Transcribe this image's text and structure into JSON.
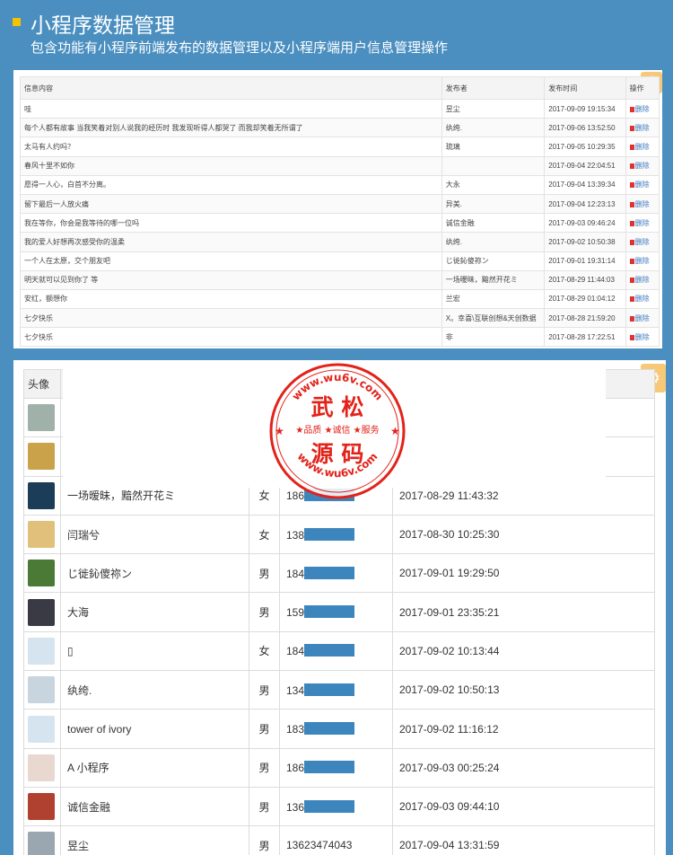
{
  "header": {
    "title": "小程序数据管理",
    "subtitle": "包含功能有小程序前端发布的数据管理以及小程序端用户信息管理操作"
  },
  "messages": {
    "columns": [
      "信息内容",
      "发布者",
      "发布时间",
      "操作"
    ],
    "delete_label": "删除",
    "rows": [
      {
        "content": "哇",
        "author": "昱尘",
        "time": "2017-09-09 19:15:34"
      },
      {
        "content": "每个人都有故事 当我笑着对别人说我的经历时 我发现听得人都哭了 而我却笑着无所谓了",
        "author": "纨绔.",
        "time": "2017-09-06 13:52:50"
      },
      {
        "content": "太马有人约吗？",
        "author": "琉璃",
        "time": "2017-09-05 10:29:35"
      },
      {
        "content": "春风十里不如你",
        "author": "",
        "time": "2017-09-04 22:04:51"
      },
      {
        "content": "愿得一人心，白首不分离。",
        "author": "大永",
        "time": "2017-09-04 13:39:34"
      },
      {
        "content": "留下最后一人放火痛",
        "author": "异美.",
        "time": "2017-09-04 12:23:13"
      },
      {
        "content": "我在等你，你会是我等待的哪一位吗",
        "author": "诚信金融",
        "time": "2017-09-03 09:46:24"
      },
      {
        "content": "我的爱人好想再次感受你的温柔",
        "author": "纨绔.",
        "time": "2017-09-02 10:50:38"
      },
      {
        "content": "一个人在太原，交个朋友吧",
        "author": "じ徙鈊傻祢ン",
        "time": "2017-09-01 19:31:14"
      },
      {
        "content": "明天就可以见到你了 等",
        "author": "一场暧昧，黯然开花ミ",
        "time": "2017-08-29 11:44:03"
      },
      {
        "content": "安红，额想你",
        "author": "兰宏",
        "time": "2017-08-29 01:04:12"
      },
      {
        "content": "七夕快乐",
        "author": "X。幸喜\\互联创想&天创数据",
        "time": "2017-08-28 21:59:20"
      },
      {
        "content": "七夕快乐",
        "author": "非",
        "time": "2017-08-28 17:22:51"
      }
    ]
  },
  "users": {
    "header_label": "头像",
    "rows": [
      {
        "name": "",
        "gender": "",
        "phone": "",
        "time": "",
        "avatar_color": "#9fb1a8"
      },
      {
        "name": "",
        "gender": "",
        "phone": "",
        "time": "",
        "avatar_color": "#c9a24a"
      },
      {
        "name": "一场暧昧，黯然开花ミ",
        "gender": "女",
        "phone": "186",
        "time": "2017-08-29 11:43:32",
        "avatar_color": "#1c3d58"
      },
      {
        "name": "闫瑞兮",
        "gender": "女",
        "phone": "138",
        "time": "2017-08-30 10:25:30",
        "avatar_color": "#e0c07a"
      },
      {
        "name": "じ徙鈊傻祢ン",
        "gender": "男",
        "phone": "184",
        "time": "2017-09-01 19:29:50",
        "avatar_color": "#4a7a35"
      },
      {
        "name": "大海",
        "gender": "男",
        "phone": "159",
        "time": "2017-09-01 23:35:21",
        "avatar_color": "#3a3a44"
      },
      {
        "name": "▯",
        "gender": "女",
        "phone": "184",
        "time": "2017-09-02 10:13:44",
        "avatar_color": "#d6e4ef"
      },
      {
        "name": "纨绔.",
        "gender": "男",
        "phone": "134",
        "time": "2017-09-02 10:50:13",
        "avatar_color": "#c8d4de"
      },
      {
        "name": "tower of ivory",
        "gender": "男",
        "phone": "183",
        "time": "2017-09-02 11:16:12",
        "avatar_color": "#d6e4ef"
      },
      {
        "name": "A 小程序",
        "gender": "男",
        "phone": "186",
        "time": "2017-09-03 00:25:24",
        "avatar_color": "#e8d8d0"
      },
      {
        "name": "诚信金融",
        "gender": "男",
        "phone": "136",
        "time": "2017-09-03 09:44:10",
        "avatar_color": "#b04030"
      },
      {
        "name": "昱尘",
        "gender": "男",
        "phone": "13623474043",
        "time": "2017-09-04 13:31:59",
        "avatar_color": "#9aa6b0"
      }
    ]
  },
  "watermark": {
    "top_text": "www.wu6v.com",
    "line1": "武 松",
    "middle": "★品质 ★诚信 ★服务",
    "line2": "源 码",
    "bottom_text": "www.wu6v.com",
    "color": "#e2231a"
  },
  "icons": {
    "gear": "gear-icon",
    "delete": "trash-icon"
  }
}
